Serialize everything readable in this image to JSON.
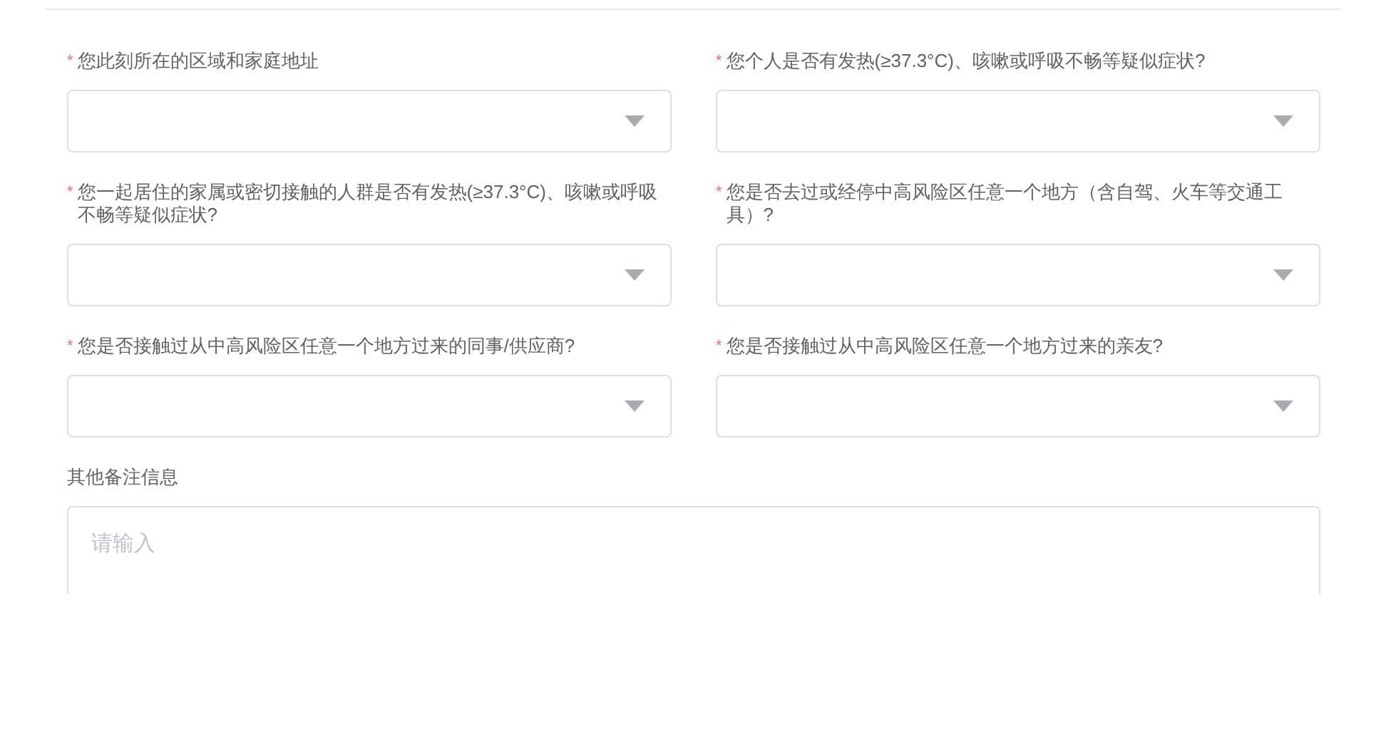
{
  "fields": [
    {
      "kind": "select",
      "required_mark": "*",
      "label": "您此刻所在的区域和家庭地址"
    },
    {
      "kind": "select",
      "required_mark": "*",
      "label": "您个人是否有发热(≥37.3°C)、咳嗽或呼吸不畅等疑似症状?"
    },
    {
      "kind": "select",
      "required_mark": "*",
      "label": "您一起居住的家属或密切接触的人群是否有发热(≥37.3°C)、咳嗽或呼吸不畅等疑似症状?"
    },
    {
      "kind": "select",
      "required_mark": "*",
      "label": "您是否去过或经停中高风险区任意一个地方（含自驾、火车等交通工具）?"
    },
    {
      "kind": "select",
      "required_mark": "*",
      "label": "您是否接触过从中高风险区任意一个地方过来的同事/供应商?"
    },
    {
      "kind": "select",
      "required_mark": "*",
      "label": "您是否接触过从中高风险区任意一个地方过来的亲友?"
    },
    {
      "kind": "textarea",
      "label": "其他备注信息",
      "placeholder": "请输入"
    }
  ]
}
